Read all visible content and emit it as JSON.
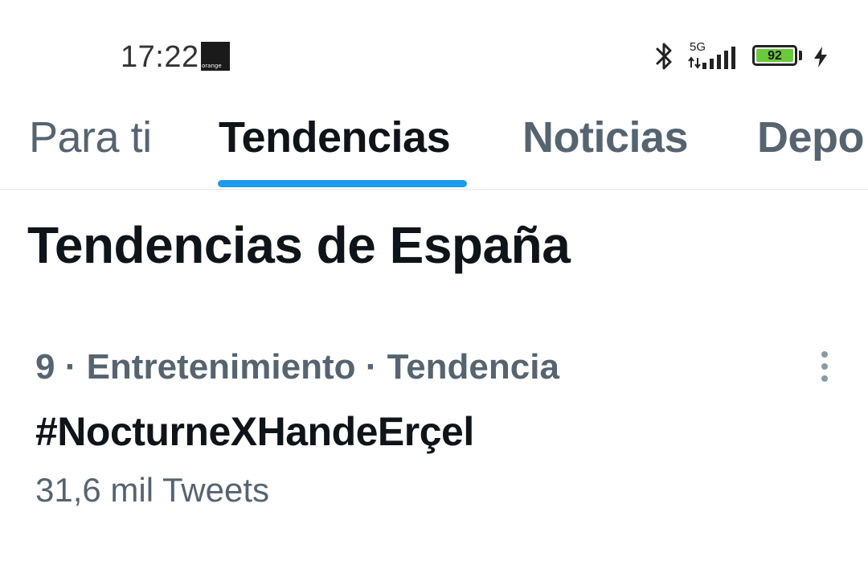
{
  "status_bar": {
    "time": "17:22",
    "carrier": "orange",
    "network": "5G",
    "battery_level": "92",
    "icons": [
      "bluetooth-icon",
      "signal-icon",
      "battery-icon",
      "charging-icon"
    ]
  },
  "tabs": [
    {
      "label": "Para ti",
      "active": false
    },
    {
      "label": "Tendencias",
      "active": true
    },
    {
      "label": "Noticias",
      "active": false
    },
    {
      "label": "Depo",
      "active": false
    }
  ],
  "section": {
    "title": "Tendencias de España"
  },
  "trends": [
    {
      "meta": "9 · Entretenimiento · Tendencia",
      "name": "#NocturneXHandeErçel",
      "count": "31,6 mil Tweets"
    }
  ],
  "colors": {
    "accent": "#1d9bf0",
    "text_primary": "#0f1419",
    "text_secondary": "#566470",
    "battery": "#6ac93a"
  }
}
